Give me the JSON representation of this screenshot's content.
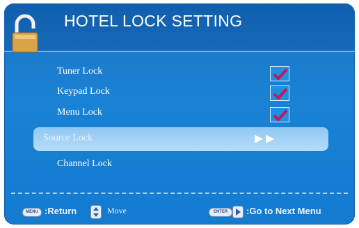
{
  "header": {
    "title": "HOTEL LOCK SETTING",
    "icon": "padlock-open-icon"
  },
  "menu": {
    "items": [
      {
        "label": "Tuner Lock",
        "checked": true
      },
      {
        "label": "Keypad Lock",
        "checked": true
      },
      {
        "label": "Menu Lock",
        "checked": true
      },
      {
        "label": "Source Lock",
        "selected": true,
        "indicator": "double-arrow-right-icon"
      },
      {
        "label": "Channel Lock"
      }
    ]
  },
  "footer": {
    "menu_key": "MENU",
    "return_label": ":Return",
    "move_label": "Move",
    "enter_key": "ENTER",
    "next_label": ":Go to Next Menu"
  },
  "colors": {
    "background": "#1a82d4",
    "header": "#0f5fae",
    "selected_row": "#b7dcf9",
    "checkmark": "#c2185b"
  }
}
